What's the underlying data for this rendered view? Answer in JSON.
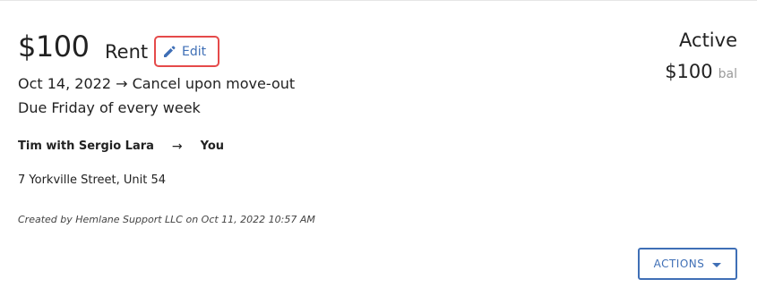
{
  "charge": {
    "amount": "$100",
    "type": "Rent",
    "edit_label": "Edit",
    "dates": "Oct 14, 2022 → Cancel upon move-out",
    "due": "Due Friday of every week",
    "from": "Tim with Sergio Lara",
    "arrow": "→",
    "to": "You",
    "address": "7 Yorkville Street, Unit 54",
    "created": "Created by Hemlane Support LLC on Oct 11, 2022 10:57 AM"
  },
  "status": {
    "state": "Active",
    "balance_amount": "$100",
    "balance_suffix": "bal"
  },
  "actions": {
    "label": "ACTIONS"
  },
  "icons": {
    "edit": "pencil-icon",
    "actions_dropdown": "caret-down-icon"
  },
  "colors": {
    "accent": "#3f6fb6",
    "highlight": "#e54a4a",
    "muted": "#9a9a9a"
  }
}
